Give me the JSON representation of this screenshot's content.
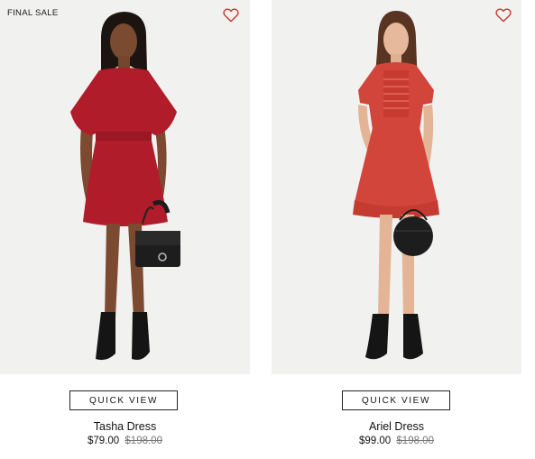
{
  "products": [
    {
      "badge": "FINAL SALE",
      "name": "Tasha Dress",
      "price": "$79.00",
      "original_price": "$198.00",
      "quick_view_label": "QUICK VIEW",
      "favorite_icon": "heart-outline-icon",
      "dress_color": "#b01c2a"
    },
    {
      "name": "Ariel Dress",
      "price": "$99.00",
      "original_price": "$198.00",
      "quick_view_label": "QUICK VIEW",
      "favorite_icon": "heart-outline-icon",
      "dress_color": "#d2453a"
    }
  ],
  "colors": {
    "heart": "#c0392b",
    "photo_background": "#f1f1f0",
    "text": "#111111",
    "strikethrough_price": "#777777"
  }
}
